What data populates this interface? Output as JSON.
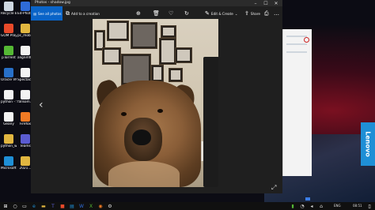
{
  "photos_app": {
    "title": "Photos - shadow.jpg",
    "see_all_label": "See all photos",
    "add_to_creation_label": "Add to a creation",
    "edit_create_label": "Edit & Create",
    "share_label": "Share",
    "more_label": "…",
    "nav_prev": "‹",
    "icons": [
      "zoom-icon",
      "delete-icon",
      "favourite-icon",
      "rotate-icon",
      "edit-icon",
      "share-icon",
      "print-icon",
      "more-icon",
      "expand-icon"
    ]
  },
  "desktop": {
    "icons": [
      {
        "label": "Recycle Bin",
        "color": "#cfd8e3"
      },
      {
        "label": "Ed-Photo 2018-...",
        "color": "#2f6bd8"
      },
      {
        "label": "",
        "color": "#e3e3e3"
      },
      {
        "label": "",
        "color": "#2a82d2"
      },
      {
        "label": "GOM Player",
        "color": "#e84a2a"
      },
      {
        "label": "pc_mobile...",
        "color": "#e1b640"
      },
      {
        "label": "",
        "color": "#e9e9e9"
      },
      {
        "label": "",
        "color": "#e9e9e9"
      },
      {
        "label": "pTorrent",
        "color": "#55b835"
      },
      {
        "label": "alignmfile...",
        "color": "#f3f3f3"
      },
      {
        "label": "",
        "color": "#e9e9e9"
      },
      {
        "label": "",
        "color": "#e9e9e9"
      },
      {
        "label": "Oracle VM VirtualBox",
        "color": "#2870c8"
      },
      {
        "label": "Spectacle VirtualBox",
        "color": "#f3f3f3"
      },
      {
        "label": "",
        "color": "#e9e9e9"
      },
      {
        "label": "",
        "color": "#e9e9e9"
      },
      {
        "label": "python - Shortcut",
        "color": "#f3f3f3"
      },
      {
        "label": "fallsom...",
        "color": "#f3f3f3"
      },
      {
        "label": "",
        "color": "#e9e9e9"
      },
      {
        "label": "",
        "color": "#e9e9e9"
      },
      {
        "label": "Geany",
        "color": "#f3f3f3"
      },
      {
        "label": "Firefox",
        "color": "#f07a24"
      },
      {
        "label": "",
        "color": "#e9e9e9"
      },
      {
        "label": "",
        "color": "#e9e9e9"
      },
      {
        "label": "python_work",
        "color": "#e1b640"
      },
      {
        "label": "Teams",
        "color": "#5a5bd1"
      },
      {
        "label": "",
        "color": "#e9e9e9"
      },
      {
        "label": "",
        "color": "#e9e9e9"
      },
      {
        "label": "Microsoft Edge",
        "color": "#1f8fd6"
      },
      {
        "label": "2021...",
        "color": "#e1b640"
      }
    ]
  },
  "wallpaper": {
    "brand": "Lenovo"
  },
  "taskbar": {
    "tray": {
      "lang": "ENG",
      "time": "08:51"
    }
  }
}
